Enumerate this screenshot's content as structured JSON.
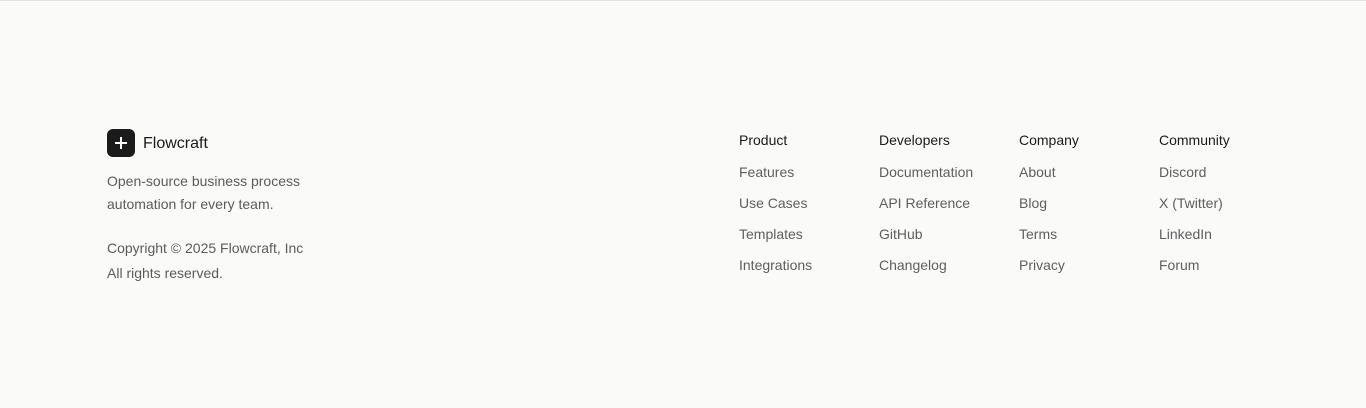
{
  "brand": {
    "name": "Flowcraft",
    "logo_icon": "plus-icon",
    "tagline": "Open-source business process automation for every team.",
    "copyright_line1": "Copyright © 2025 Flowcraft, Inc",
    "copyright_line2": "All rights reserved."
  },
  "columns": [
    {
      "heading": "Product",
      "links": [
        "Features",
        "Use Cases",
        "Templates",
        "Integrations"
      ]
    },
    {
      "heading": "Developers",
      "links": [
        "Documentation",
        "API Reference",
        "GitHub",
        "Changelog"
      ]
    },
    {
      "heading": "Company",
      "links": [
        "About",
        "Blog",
        "Terms",
        "Privacy"
      ]
    },
    {
      "heading": "Community",
      "links": [
        "Discord",
        "X (Twitter)",
        "LinkedIn",
        "Forum"
      ]
    }
  ],
  "colors": {
    "background": "#fafaf9",
    "logo_bg": "#1b1b1b",
    "text_primary": "#1a1a1a",
    "text_muted": "#5b5b5b"
  }
}
